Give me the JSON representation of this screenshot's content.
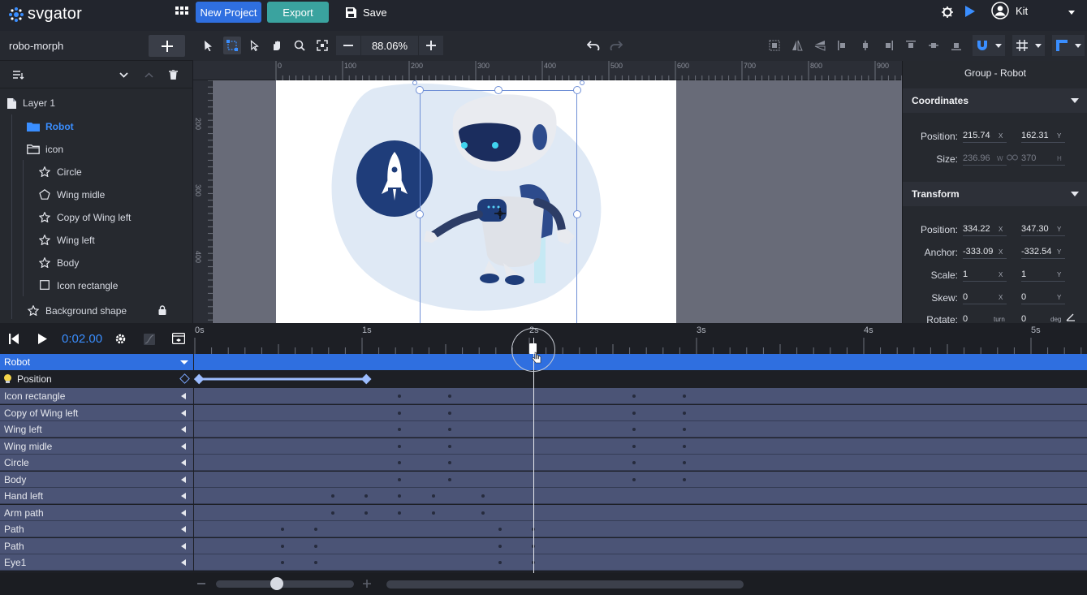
{
  "app": {
    "logo_text": "svgator",
    "new_project": "New Project",
    "export": "Export",
    "save": "Save",
    "user": "Kit",
    "colors": {
      "primary": "#2f6fe0",
      "export": "#3aa39f",
      "accent": "#3a8eff",
      "track": "#4b5476"
    }
  },
  "project": {
    "name": "robo-morph"
  },
  "toolbar": {
    "zoom": "88.06%"
  },
  "ruler": {
    "top_labels": [
      "0",
      "100",
      "200",
      "300",
      "400",
      "500",
      "600",
      "700",
      "800",
      "900"
    ],
    "left_labels": [
      "200",
      "300",
      "400"
    ]
  },
  "layers": {
    "root": "Layer 1",
    "items": [
      {
        "label": "Robot",
        "icon": "folder-icon",
        "selected": true
      },
      {
        "label": "icon",
        "icon": "folder-icon"
      },
      {
        "label": "Circle",
        "icon": "star-icon"
      },
      {
        "label": "Wing midle",
        "icon": "pentagon-icon"
      },
      {
        "label": "Copy of Wing left",
        "icon": "star-icon"
      },
      {
        "label": "Wing left",
        "icon": "star-icon"
      },
      {
        "label": "Body",
        "icon": "star-icon"
      },
      {
        "label": "Icon rectangle",
        "icon": "square-icon"
      },
      {
        "label": "Background shape",
        "icon": "star-icon",
        "locked": true
      }
    ]
  },
  "props": {
    "group_title": "Group - Robot",
    "coordinates": {
      "title": "Coordinates",
      "position_label": "Position:",
      "position_x": "215.74",
      "position_y": "162.31",
      "size_label": "Size:",
      "size_w": "236.96",
      "size_h": "370"
    },
    "transform": {
      "title": "Transform",
      "position_label": "Position:",
      "position_x": "334.22",
      "position_y": "347.30",
      "anchor_label": "Anchor:",
      "anchor_x": "-333.09",
      "anchor_y": "-332.54",
      "scale_label": "Scale:",
      "scale_x": "1",
      "scale_y": "1",
      "skew_label": "Skew:",
      "skew_x": "0",
      "skew_y": "0",
      "rotate_label": "Rotate:",
      "rotate_turn": "0",
      "rotate_deg": "0"
    },
    "units": {
      "x": "X",
      "y": "Y",
      "w": "W",
      "h": "H",
      "turn": "turn",
      "deg": "deg"
    }
  },
  "timeline": {
    "time": "0:02.00",
    "ruler_labels": [
      "0s",
      "1s",
      "2s",
      "3s",
      "4s",
      "5s"
    ],
    "group_track": "Robot",
    "position_track": "Position",
    "tracks": [
      {
        "name": "Icon rectangle",
        "dots": [
          1.23,
          1.53,
          2.63,
          2.93
        ]
      },
      {
        "name": "Copy of Wing left",
        "dots": [
          1.23,
          1.53,
          2.63,
          2.93
        ]
      },
      {
        "name": "Wing left",
        "dots": [
          1.23,
          1.53,
          2.63,
          2.93
        ]
      },
      {
        "name": "Wing midle",
        "dots": [
          1.23,
          1.53,
          2.63,
          2.93
        ]
      },
      {
        "name": "Circle",
        "dots": [
          1.23,
          1.53,
          2.63,
          2.93
        ]
      },
      {
        "name": "Body",
        "dots": [
          1.23,
          1.53,
          2.63,
          2.93
        ]
      },
      {
        "name": "Hand left",
        "dots": [
          0.83,
          1.03,
          1.23,
          1.43,
          1.73
        ]
      },
      {
        "name": "Arm path",
        "dots": [
          0.83,
          1.03,
          1.23,
          1.43,
          1.73
        ]
      },
      {
        "name": "Path",
        "dots": [
          0.53,
          0.73,
          1.83,
          2.03
        ]
      },
      {
        "name": "Path",
        "dots": [
          0.53,
          0.73,
          1.83,
          2.03
        ]
      },
      {
        "name": "Eye1",
        "dots": [
          0.53,
          0.73,
          1.83,
          2.03
        ]
      }
    ],
    "position_keyframes": [
      0.03,
      1.03
    ],
    "playhead_sec": 2.03
  }
}
